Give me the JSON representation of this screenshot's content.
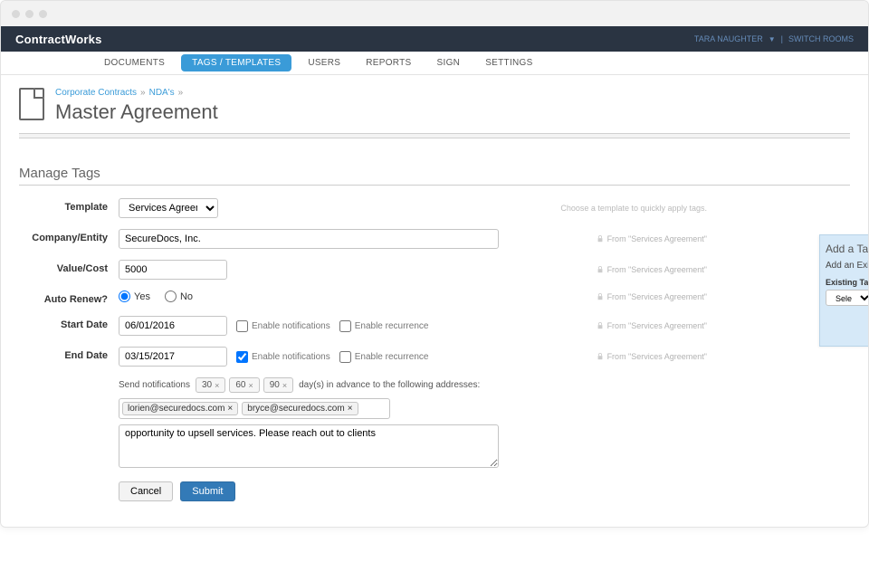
{
  "brand": "ContractWorks",
  "user": {
    "name": "TARA NAUGHTER",
    "switch": "SWITCH ROOMS"
  },
  "nav": {
    "items": [
      "DOCUMENTS",
      "TAGS / TEMPLATES",
      "USERS",
      "REPORTS",
      "SIGN",
      "SETTINGS"
    ],
    "active_index": 1
  },
  "breadcrumb": {
    "a": "Corporate Contracts",
    "b": "NDA's"
  },
  "page_title": "Master Agreement",
  "section_title": "Manage Tags",
  "template": {
    "label": "Template",
    "selected": "Services Agreement",
    "help": "Choose a template to quickly apply tags."
  },
  "company": {
    "label": "Company/Entity",
    "value": "SecureDocs, Inc."
  },
  "value": {
    "label": "Value/Cost",
    "value": "5000"
  },
  "auto_renew": {
    "label": "Auto Renew?",
    "yes": "Yes",
    "no": "No",
    "selected": "yes"
  },
  "start_date": {
    "label": "Start Date",
    "value": "06/01/2016",
    "enable_notifications": "Enable notifications",
    "enable_recurrence": "Enable recurrence",
    "notif_checked": false
  },
  "end_date": {
    "label": "End Date",
    "value": "03/15/2017",
    "enable_notifications": "Enable notifications",
    "enable_recurrence": "Enable recurrence",
    "notif_checked": true
  },
  "from_template_text": "From \"Services Agreement\"",
  "notifications": {
    "prefix": "Send notifications",
    "days": [
      "30",
      "60",
      "90"
    ],
    "suffix": "day(s) in advance to the following addresses:",
    "emails": [
      "lorien@securedocs.com",
      "bryce@securedocs.com"
    ],
    "notes": "opportunity to upsell services. Please reach out to clients"
  },
  "actions": {
    "cancel": "Cancel",
    "submit": "Submit"
  },
  "side_panel": {
    "title": "Add a Tag",
    "sub": "Add an Existing Tag",
    "existing": "Existing Tag",
    "select": "Select a Tag"
  }
}
